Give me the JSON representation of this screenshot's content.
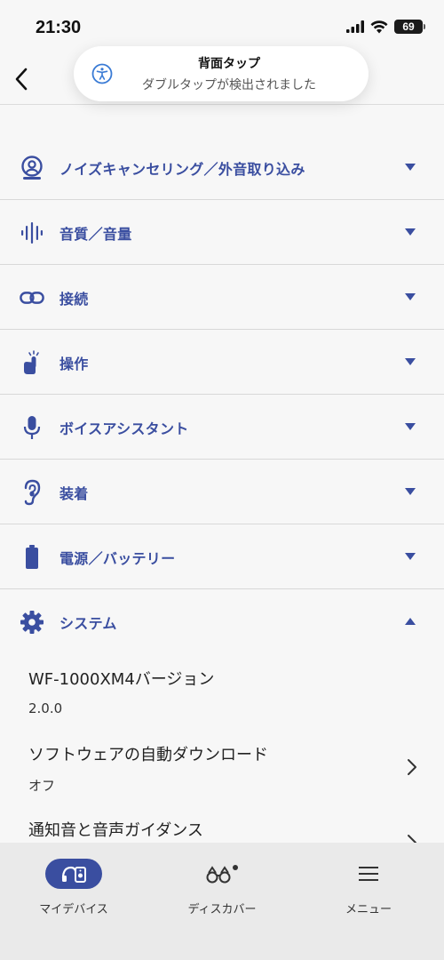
{
  "status_bar": {
    "time": "21:30",
    "battery": "69",
    "icons": [
      "signal-icon",
      "wifi-icon",
      "battery-icon"
    ]
  },
  "toast": {
    "icon": "accessibility-icon",
    "title": "背面タップ",
    "subtitle": "ダブルタップが検出されました"
  },
  "header": {
    "back_icon": "chevron-left-icon"
  },
  "sections": [
    {
      "label": "ノイズキャンセリング／外音取り込み",
      "icon": "noise-cancel-icon",
      "expanded": false
    },
    {
      "label": "音質／音量",
      "icon": "sound-wave-icon",
      "expanded": false
    },
    {
      "label": "接続",
      "icon": "link-icon",
      "expanded": false
    },
    {
      "label": "操作",
      "icon": "tap-hand-icon",
      "expanded": false
    },
    {
      "label": "ボイスアシスタント",
      "icon": "microphone-icon",
      "expanded": false
    },
    {
      "label": "装着",
      "icon": "ear-icon",
      "expanded": false
    },
    {
      "label": "電源／バッテリー",
      "icon": "battery-icon",
      "expanded": false
    },
    {
      "label": "システム",
      "icon": "gear-icon",
      "expanded": true
    }
  ],
  "system": {
    "items": [
      {
        "title": "WF-1000XM4バージョン",
        "value": "2.0.0"
      },
      {
        "title": "ソフトウェアの自動ダウンロード",
        "value": "オフ"
      },
      {
        "title": "通知音と音声ガイダンス",
        "value": ""
      }
    ]
  },
  "bottom_nav": {
    "items": [
      {
        "label": "マイデバイス",
        "icon": "headphones-icon",
        "active": true
      },
      {
        "label": "ディスカバー",
        "icon": "binoculars-icon",
        "active": false
      },
      {
        "label": "メニュー",
        "icon": "menu-icon",
        "active": false
      }
    ]
  },
  "colors": {
    "accent": "#3a4ea0",
    "background": "#f7f7f7",
    "nav_background": "#eaeaea"
  }
}
